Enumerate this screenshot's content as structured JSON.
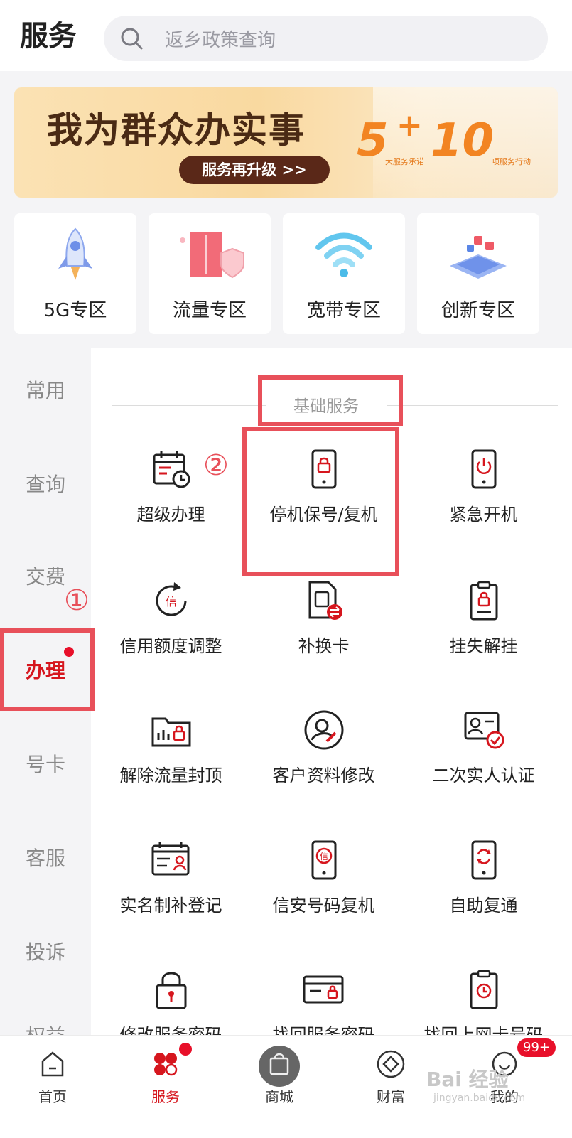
{
  "header": {
    "title": "服务",
    "search_placeholder": "返乡政策查询"
  },
  "banner": {
    "title": "我为群众办实事",
    "button": "服务再升级 >>",
    "num_a": "5",
    "plus": "+",
    "num_b": "10",
    "sub_a": "大服务承诺",
    "sub_b": "项服务行动"
  },
  "zones": [
    {
      "label": "5G专区",
      "icon": "rocket-icon"
    },
    {
      "label": "流量专区",
      "icon": "cabinet-shield-icon"
    },
    {
      "label": "宽带专区",
      "icon": "wifi-icon"
    },
    {
      "label": "创新专区",
      "icon": "laptop-apps-icon"
    }
  ],
  "sidebar": {
    "items": [
      "常用",
      "查询",
      "交费",
      "办理",
      "号卡",
      "客服",
      "投诉",
      "权益"
    ],
    "active": "办理"
  },
  "section": {
    "title": "基础服务"
  },
  "services": [
    {
      "label": "超级办理",
      "icon": "calendar-clock-icon"
    },
    {
      "label": "停机保号/复机",
      "icon": "phone-lock-icon"
    },
    {
      "label": "紧急开机",
      "icon": "phone-power-icon"
    },
    {
      "label": "信用额度调整",
      "icon": "credit-refresh-icon"
    },
    {
      "label": "补换卡",
      "icon": "sim-swap-icon"
    },
    {
      "label": "挂失解挂",
      "icon": "clipboard-lock-icon"
    },
    {
      "label": "解除流量封顶",
      "icon": "folder-lock-icon"
    },
    {
      "label": "客户资料修改",
      "icon": "user-edit-icon"
    },
    {
      "label": "二次实人认证",
      "icon": "id-check-icon"
    },
    {
      "label": "实名制补登记",
      "icon": "calendar-user-icon"
    },
    {
      "label": "信安号码复机",
      "icon": "phone-credit-icon"
    },
    {
      "label": "自助复通",
      "icon": "phone-refresh-icon"
    },
    {
      "label": "修改服务密码",
      "icon": "padlock-icon"
    },
    {
      "label": "找回服务密码",
      "icon": "card-lock-icon"
    },
    {
      "label": "找回上网卡号码",
      "icon": "clipboard-clock-icon"
    }
  ],
  "annotations": {
    "marker_1": "①",
    "marker_2": "②"
  },
  "bottom_nav": [
    {
      "label": "首页",
      "icon": "home-icon"
    },
    {
      "label": "服务",
      "icon": "service-grid-icon"
    },
    {
      "label": "商城",
      "icon": "shopping-bag-icon"
    },
    {
      "label": "财富",
      "icon": "diamond-icon"
    },
    {
      "label": "我的",
      "icon": "profile-icon"
    }
  ],
  "badge": "99+",
  "watermark": {
    "line1": "Bai 经验",
    "line2": "jingyan.baidu.com"
  },
  "colors": {
    "accent": "#d6161e",
    "annotation": "#e8505a",
    "banner_orange": "#f28422",
    "banner_brown": "#5a2818"
  }
}
